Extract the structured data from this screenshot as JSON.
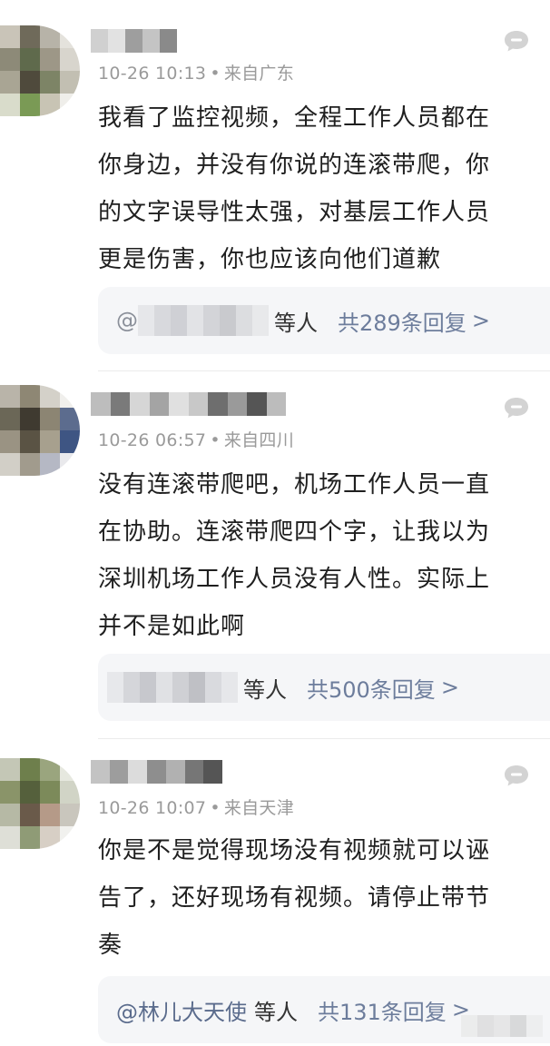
{
  "comments": [
    {
      "time": "10-26 10:13",
      "location": "来自广东",
      "text_lines": [
        "我看了监控视频，全程工作人员都在",
        "你身边，并没有你说的连滚带爬，你",
        "的文字误导性太强，对基层工作人员",
        "更是伤害，你也应该向他们道歉"
      ],
      "reply_prefix": "@",
      "reply_suffix": "等人",
      "reply_total": "共289条回复",
      "chevron": ">"
    },
    {
      "time": "10-26 06:57",
      "location": "来自四川",
      "text_lines": [
        "没有连滚带爬吧，机场工作人员一直",
        "在协助。连滚带爬四个字，让我以为",
        "深圳机场工作人员没有人性。实际上",
        "并不是如此啊"
      ],
      "reply_suffix": "等人",
      "reply_total": "共500条回复",
      "chevron": ">"
    },
    {
      "time": "10-26 10:07",
      "location": "来自天津",
      "text_lines": [
        "你是不是觉得现场没有视频就可以诬",
        "告了，还好现场有视频。请停止带节",
        "奏"
      ],
      "reply_user": "@林儿大天使",
      "reply_suffix": "等人",
      "reply_total": "共131条回复",
      "chevron": ">"
    }
  ],
  "meta_separator": "•",
  "icons": {
    "reply": "comment-bubble-icon"
  },
  "colors": {
    "meta": "#9a9a9a",
    "reply_link": "#6d7d9c",
    "reply_box_bg": "#f5f6f8",
    "icon": "#d3d3d3"
  }
}
